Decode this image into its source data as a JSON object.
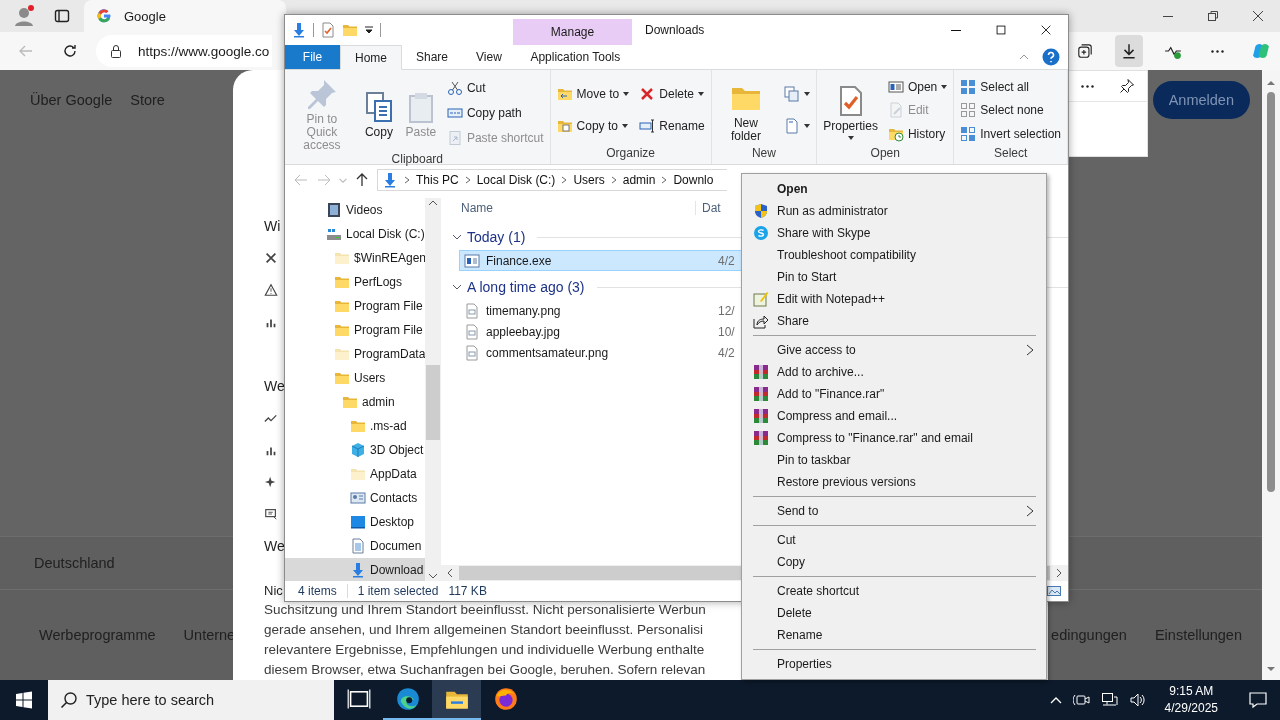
{
  "browser": {
    "tab": {
      "title": "Google"
    },
    "address": {
      "url": "https://www.google.co"
    },
    "page": {
      "header_links": [
        "Über Google",
        "Store"
      ],
      "sign_in_button": "Anmelden",
      "dialog": {
        "sections": [
          {
            "heading": "Wi"
          },
          {
            "heading": "We"
          },
          {
            "heading": "We"
          }
        ],
        "notice_heading": "Nic",
        "lines": [
          "Suchsitzung und Ihrem Standort beeinflusst. Nicht personalisierte Werbun",
          "gerade ansehen, und Ihrem allgemeinen Standort beeinflusst. Personalisi",
          "relevantere Ergebnisse, Empfehlungen und individuelle Werbung enthalte",
          "diesem Browser, etwa Suchanfragen bei Google, beruhen. Sofern relevan"
        ]
      },
      "country": "Deutschland",
      "footer_left": [
        "Werbeprogramme",
        "Unterne"
      ],
      "footer_right": [
        "edingungen",
        "Einstellungen"
      ]
    }
  },
  "explorer": {
    "title": "Downloads",
    "tabs": [
      {
        "label": "File",
        "kind": "file",
        "selected": false
      },
      {
        "label": "Home",
        "kind": "tab",
        "selected": true
      },
      {
        "label": "Share",
        "kind": "tab",
        "selected": false
      },
      {
        "label": "View",
        "kind": "tab",
        "selected": false
      },
      {
        "label": "Application Tools",
        "kind": "context",
        "context_label": "Manage",
        "selected": false
      }
    ],
    "ribbon": [
      {
        "label": "Clipboard",
        "columns": [
          [
            {
              "label": "Pin to Quick access",
              "kind": "pin",
              "large": true,
              "disabled": true,
              "dropdown": false
            }
          ],
          [
            {
              "label": "Copy",
              "kind": "copy",
              "large": true,
              "disabled": false,
              "dropdown": false
            }
          ],
          [
            {
              "label": "Paste",
              "kind": "paste",
              "large": true,
              "disabled": true,
              "dropdown": false
            }
          ],
          [
            {
              "label": "Cut",
              "kind": "cut",
              "large": false,
              "disabled": false,
              "dropdown": false
            },
            {
              "label": "Copy path",
              "kind": "copypath",
              "large": false,
              "disabled": false,
              "dropdown": false
            },
            {
              "label": "Paste shortcut",
              "kind": "pasteshortcut",
              "large": false,
              "disabled": true,
              "dropdown": false
            }
          ]
        ]
      },
      {
        "label": "Organize",
        "columns": [
          [
            {
              "label": "Move to",
              "kind": "move",
              "large": false,
              "disabled": false,
              "dropdown": true
            },
            {
              "label": "Copy to",
              "kind": "copyto",
              "large": false,
              "disabled": false,
              "dropdown": true
            }
          ],
          [
            {
              "label": "Delete",
              "kind": "delete",
              "large": false,
              "disabled": false,
              "dropdown": true
            },
            {
              "label": "Rename",
              "kind": "rename",
              "large": false,
              "disabled": false,
              "dropdown": false
            }
          ]
        ]
      },
      {
        "label": "New",
        "columns": [
          [
            {
              "label": "New folder",
              "kind": "newfolder",
              "large": true,
              "disabled": false,
              "dropdown": false
            }
          ],
          [
            {
              "kind": "newitem",
              "large": false,
              "disabled": false,
              "dropdown": true
            },
            {
              "kind": "easyaccess",
              "large": false,
              "disabled": false,
              "dropdown": true
            }
          ]
        ]
      },
      {
        "label": "Open",
        "columns": [
          [
            {
              "label": "Properties",
              "kind": "properties",
              "large": true,
              "disabled": false,
              "dropdown": true
            }
          ],
          [
            {
              "label": "Open",
              "kind": "open",
              "large": false,
              "disabled": false,
              "dropdown": true
            },
            {
              "label": "Edit",
              "kind": "edit",
              "large": false,
              "disabled": true,
              "dropdown": false
            },
            {
              "label": "History",
              "kind": "history",
              "large": false,
              "disabled": false,
              "dropdown": false
            }
          ]
        ]
      },
      {
        "label": "Select",
        "columns": [
          [
            {
              "label": "Select all",
              "kind": "selectall",
              "large": false,
              "disabled": false,
              "dropdown": false
            },
            {
              "label": "Select none",
              "kind": "selectnone",
              "large": false,
              "disabled": false,
              "dropdown": false
            },
            {
              "label": "Invert selection",
              "kind": "invert",
              "large": false,
              "disabled": false,
              "dropdown": false
            }
          ]
        ]
      }
    ],
    "breadcrumb": [
      "This PC",
      "Local Disk (C:)",
      "Users",
      "admin",
      "Downlo"
    ],
    "nav": [
      {
        "label": "Videos",
        "kind": "video",
        "selected": false
      },
      {
        "label": "Local Disk (C:)",
        "kind": "drive",
        "selected": false,
        "children": [
          {
            "label": "$WinREAgen",
            "kind": "hiddenfolder",
            "selected": false
          },
          {
            "label": "PerfLogs",
            "kind": "folder",
            "selected": false
          },
          {
            "label": "Program File",
            "kind": "folder",
            "selected": false
          },
          {
            "label": "Program File",
            "kind": "folder",
            "selected": false
          },
          {
            "label": "ProgramData",
            "kind": "hiddenfolder",
            "selected": false
          },
          {
            "label": "Users",
            "kind": "folder",
            "selected": false,
            "children": [
              {
                "label": "admin",
                "kind": "folder",
                "selected": false,
                "children": [
                  {
                    "label": ".ms-ad",
                    "kind": "folder",
                    "selected": false
                  },
                  {
                    "label": "3D Object",
                    "kind": "cube",
                    "selected": false
                  },
                  {
                    "label": "AppData",
                    "kind": "hiddenfolder",
                    "selected": false
                  },
                  {
                    "label": "Contacts",
                    "kind": "contacts",
                    "selected": false
                  },
                  {
                    "label": "Desktop",
                    "kind": "desktop",
                    "selected": false
                  },
                  {
                    "label": "Documen",
                    "kind": "documents",
                    "selected": false
                  },
                  {
                    "label": "Download",
                    "kind": "downloads",
                    "selected": true
                  }
                ]
              }
            ]
          }
        ]
      }
    ],
    "columns": [
      "Name",
      "Dat"
    ],
    "groups": [
      {
        "label": "Today (1)",
        "expanded": true,
        "files": [
          {
            "name": "Finance.exe",
            "kind": "exe",
            "date": "4/2",
            "selected": true
          }
        ]
      },
      {
        "label": "A long time ago (3)",
        "expanded": true,
        "files": [
          {
            "name": "timemany.png",
            "kind": "image",
            "date": "12/",
            "selected": false
          },
          {
            "name": "appleebay.jpg",
            "kind": "image",
            "date": "10/",
            "selected": false
          },
          {
            "name": "commentsamateur.png",
            "kind": "image",
            "date": "4/2",
            "selected": false
          }
        ]
      }
    ],
    "status": {
      "count": "4 items",
      "selection": "1 item selected",
      "size": "117 KB"
    }
  },
  "context_menu": {
    "items": [
      {
        "label": "Open",
        "kind": "plain",
        "default": true
      },
      {
        "label": "Run as administrator",
        "kind": "admin",
        "default": false
      },
      {
        "label": "Share with Skype",
        "kind": "skype",
        "default": false
      },
      {
        "label": "Troubleshoot compatibility",
        "kind": "plain",
        "default": false
      },
      {
        "label": "Pin to Start",
        "kind": "plain",
        "default": false
      },
      {
        "label": "Edit with Notepad++",
        "kind": "notepad",
        "default": false
      },
      {
        "label": "Share",
        "kind": "share",
        "default": false
      },
      {
        "kind": "separator"
      },
      {
        "label": "Give access to",
        "kind": "submenu",
        "default": false
      },
      {
        "label": "Add to archive...",
        "kind": "archive",
        "default": false
      },
      {
        "label": "Add to \"Finance.rar\"",
        "kind": "archive",
        "default": false
      },
      {
        "label": "Compress and email...",
        "kind": "archive",
        "default": false
      },
      {
        "label": "Compress to \"Finance.rar\" and email",
        "kind": "archive",
        "default": false
      },
      {
        "label": "Pin to taskbar",
        "kind": "plain",
        "default": false
      },
      {
        "label": "Restore previous versions",
        "kind": "plain",
        "default": false
      },
      {
        "kind": "separator"
      },
      {
        "label": "Send to",
        "kind": "submenu",
        "default": false
      },
      {
        "kind": "separator"
      },
      {
        "label": "Cut",
        "kind": "plain",
        "default": false
      },
      {
        "label": "Copy",
        "kind": "plain",
        "default": false
      },
      {
        "kind": "separator"
      },
      {
        "label": "Create shortcut",
        "kind": "plain",
        "default": false
      },
      {
        "label": "Delete",
        "kind": "plain",
        "default": false
      },
      {
        "label": "Rename",
        "kind": "plain",
        "default": false
      },
      {
        "kind": "separator"
      },
      {
        "label": "Properties",
        "kind": "plain",
        "default": false
      }
    ]
  },
  "taskbar": {
    "search": {
      "placeholder": "Type here to search"
    },
    "apps": [
      {
        "kind": "taskview",
        "active": false,
        "running": false
      },
      {
        "kind": "edge",
        "active": false,
        "running": true
      },
      {
        "kind": "explorer",
        "active": true,
        "running": true
      },
      {
        "kind": "firefox",
        "active": false,
        "running": false
      }
    ],
    "time": "9:15 AM",
    "date": "4/29/2025"
  }
}
